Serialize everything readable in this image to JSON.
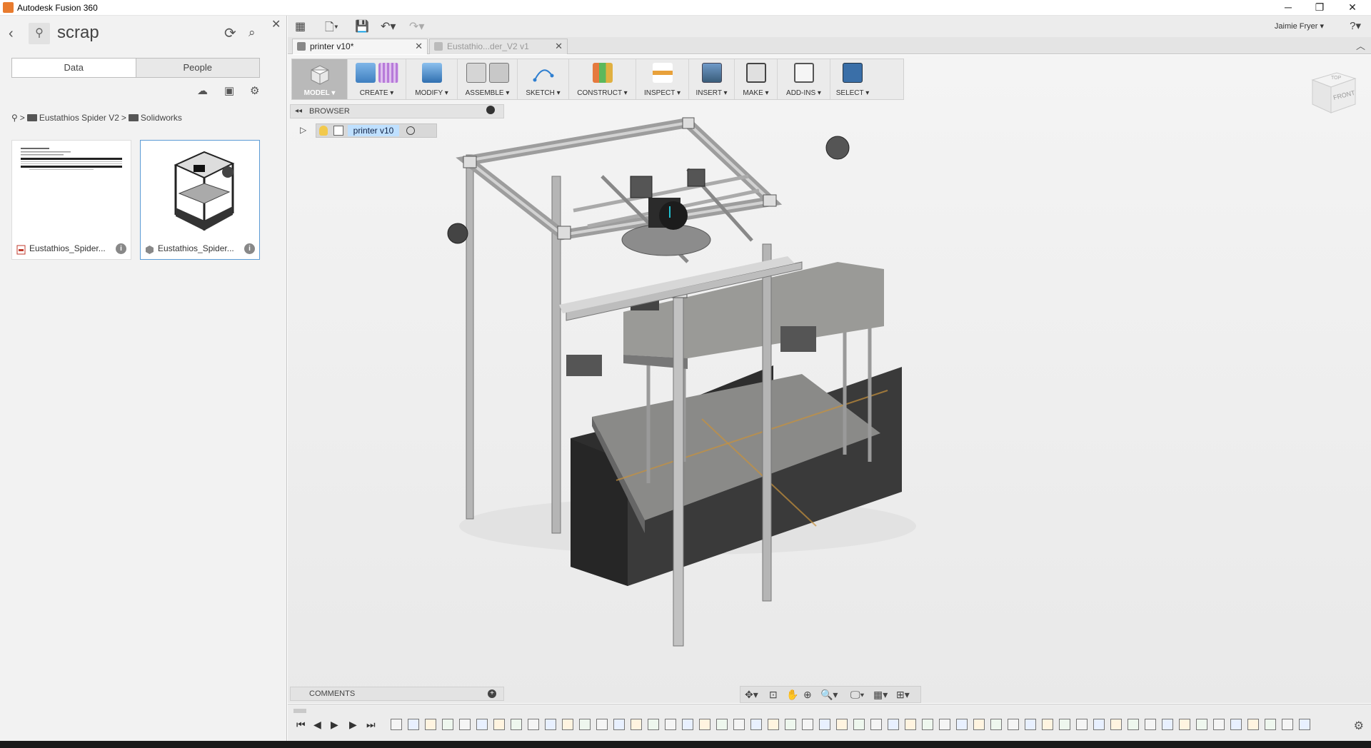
{
  "window": {
    "title": "Autodesk Fusion 360",
    "minimize": "─",
    "restore": "❐",
    "close": "✕"
  },
  "data_panel": {
    "project_name": "scrap",
    "tabs": [
      "Data",
      "People"
    ],
    "breadcrumb": [
      "Eustathios Spider V2",
      "Solidworks"
    ],
    "files": [
      {
        "name": "Eustathios_Spider...",
        "type": "pdf"
      },
      {
        "name": "Eustathios_Spider...",
        "type": "design"
      }
    ]
  },
  "doc_tabs": [
    {
      "label": "printer v10*",
      "active": true
    },
    {
      "label": "Eustathio...der_V2 v1",
      "active": false
    }
  ],
  "user": {
    "name": "Jaimie Fryer ▾",
    "help": "?▾"
  },
  "ribbon": {
    "groups": [
      {
        "label": "MODEL ▾",
        "icons": [
          "model-box-icon"
        ]
      },
      {
        "label": "CREATE ▾",
        "icons": [
          "extrude-icon",
          "form-icon"
        ]
      },
      {
        "label": "MODIFY ▾",
        "icons": [
          "press-pull-icon"
        ]
      },
      {
        "label": "ASSEMBLE ▾",
        "icons": [
          "new-component-icon",
          "joint-icon"
        ]
      },
      {
        "label": "SKETCH ▾",
        "icons": [
          "sketch-icon"
        ]
      },
      {
        "label": "CONSTRUCT ▾",
        "icons": [
          "plane-icon"
        ]
      },
      {
        "label": "INSPECT ▾",
        "icons": [
          "measure-icon"
        ]
      },
      {
        "label": "INSERT ▾",
        "icons": [
          "insert-image-icon"
        ]
      },
      {
        "label": "MAKE ▾",
        "icons": [
          "3d-print-icon"
        ]
      },
      {
        "label": "ADD-INS ▾",
        "icons": [
          "scripts-icon"
        ]
      },
      {
        "label": "SELECT ▾",
        "icons": [
          "select-icon"
        ]
      }
    ]
  },
  "browser": {
    "title": "BROWSER",
    "root_node": "printer v10"
  },
  "comments": {
    "title": "COMMENTS"
  },
  "viewcube": {
    "top": "TOP",
    "front": "FRONT"
  },
  "colors": {
    "model_tab_active": "#b9b9b9",
    "selection_blue": "#bfe0ff",
    "card_selected_border": "#5b9bd5"
  }
}
